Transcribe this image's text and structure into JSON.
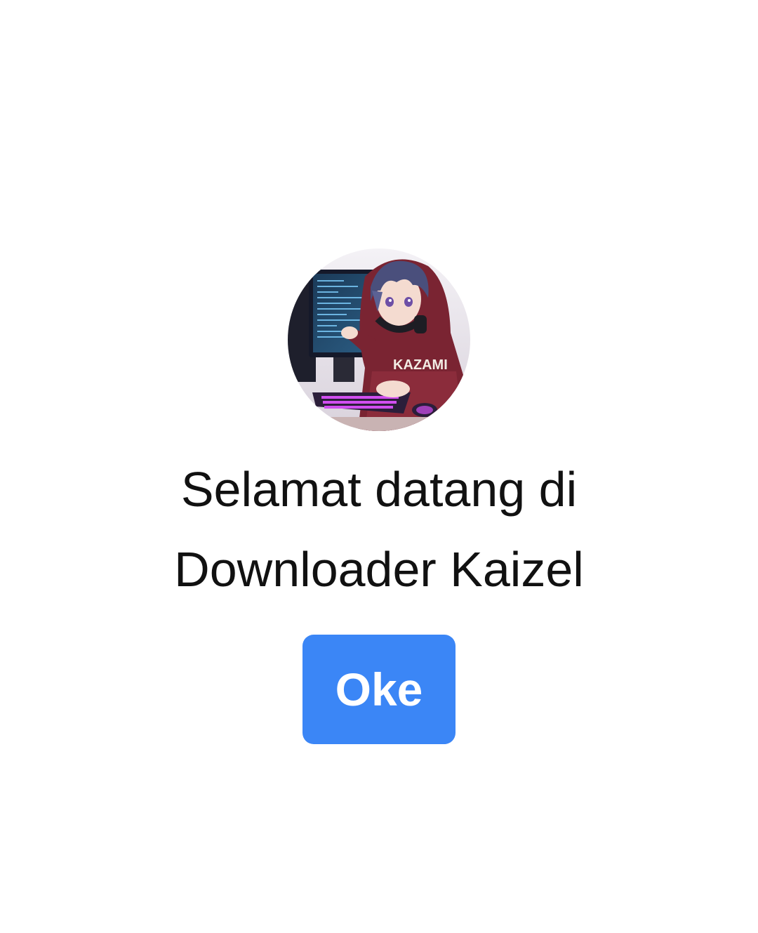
{
  "dialog": {
    "avatar": {
      "icon": "profile-avatar",
      "hoodie_text": "KAZAMI"
    },
    "title_line1": "Selamat datang di",
    "title_line2": "Downloader Kaizel",
    "ok_label": "Oke",
    "colors": {
      "background": "#ffffff",
      "button": "#3b86f6",
      "button_text": "#ffffff",
      "title_text": "#111111"
    }
  }
}
